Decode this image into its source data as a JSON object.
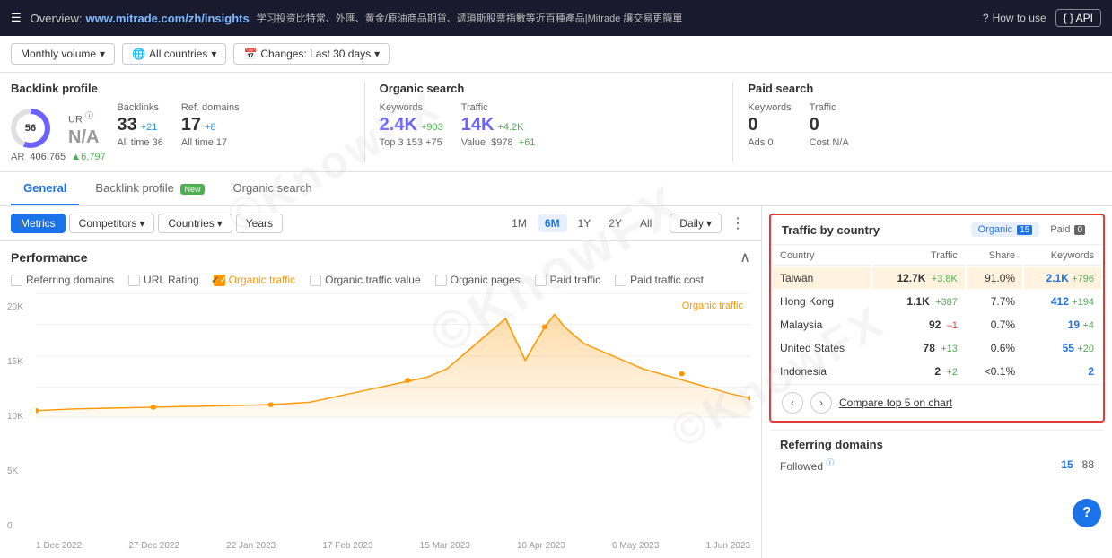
{
  "topnav": {
    "menu_label": "☰",
    "overview_label": "Overview:",
    "site_url": "www.mitrade.com/zh/insights",
    "tagline": "学习投资比特常、外匯、黄金/原油商品期貨、遞瑣斯股票指數等近百種產品|Mitrade 讓交易更簡單",
    "help_label": "How to use",
    "api_label": "{ } API"
  },
  "filters": {
    "volume_label": "Monthly volume",
    "countries_label": "All countries",
    "changes_label": "Changes: Last 30 days"
  },
  "backlink_profile": {
    "title": "Backlink profile",
    "dr_label": "DR",
    "dr_value": "56",
    "ur_label": "UR",
    "ur_value": "N/A",
    "backlinks_label": "Backlinks",
    "backlinks_value": "33",
    "backlinks_delta": "+21",
    "backlinks_sub": "All time  36",
    "refdomains_label": "Ref. domains",
    "refdomains_value": "17",
    "refdomains_delta": "+8",
    "refdomains_sub": "All time  17",
    "ar_label": "AR",
    "ar_value": "406,765",
    "ar_delta": "▲6,797"
  },
  "organic_search": {
    "title": "Organic search",
    "keywords_label": "Keywords",
    "keywords_value": "2.4K",
    "keywords_delta": "+903",
    "traffic_label": "Traffic",
    "traffic_value": "14K",
    "traffic_delta": "+4.2K",
    "top3_label": "Top 3  153  +75",
    "value_label": "Value",
    "value_value": "$978",
    "value_delta": "+61"
  },
  "paid_search": {
    "title": "Paid search",
    "keywords_label": "Keywords",
    "keywords_value": "0",
    "traffic_label": "Traffic",
    "traffic_value": "0",
    "ads_label": "Ads  0",
    "cost_label": "Cost  N/A"
  },
  "tabs": {
    "general": "General",
    "backlink_profile": "Backlink profile",
    "new_badge": "New",
    "organic_search": "Organic search"
  },
  "chart_toolbar": {
    "metrics_label": "Metrics",
    "competitors_label": "Competitors",
    "countries_label": "Countries",
    "years_label": "Years",
    "periods": [
      "1M",
      "6M",
      "1Y",
      "2Y",
      "All"
    ],
    "active_period": "6M",
    "interval_label": "Daily"
  },
  "performance": {
    "title": "Performance",
    "checkboxes": [
      {
        "label": "Referring domains",
        "checked": false
      },
      {
        "label": "URL Rating",
        "checked": false
      },
      {
        "label": "Organic traffic",
        "checked": true
      },
      {
        "label": "Organic traffic value",
        "checked": false
      },
      {
        "label": "Organic pages",
        "checked": false
      },
      {
        "label": "Paid traffic",
        "checked": false
      },
      {
        "label": "Paid traffic cost",
        "checked": false
      }
    ],
    "chart_label": "Organic traffic",
    "y_labels": [
      "20K",
      "15K",
      "10K",
      "5K",
      "0"
    ],
    "x_labels": [
      "1 Dec 2022",
      "27 Dec 2022",
      "22 Jan 2023",
      "17 Feb 2023",
      "15 Mar 2023",
      "10 Apr 2023",
      "6 May 2023",
      "1 Jun 2023"
    ]
  },
  "traffic_country": {
    "title": "Traffic by country",
    "organic_label": "Organic",
    "organic_count": "15",
    "paid_label": "Paid",
    "paid_count": "0",
    "columns": [
      "Country",
      "Traffic",
      "Share",
      "Keywords"
    ],
    "rows": [
      {
        "country": "Taiwan",
        "traffic": "12.7K",
        "delta": "+3.8K",
        "share": "91.0%",
        "keywords": "2.1K",
        "kw_delta": "+796",
        "highlight": true
      },
      {
        "country": "Hong Kong",
        "traffic": "1.1K",
        "delta": "+387",
        "share": "7.7%",
        "keywords": "412",
        "kw_delta": "+194"
      },
      {
        "country": "Malaysia",
        "traffic": "92",
        "delta": "–1",
        "share": "0.7%",
        "keywords": "19",
        "kw_delta": "+4"
      },
      {
        "country": "United States",
        "traffic": "78",
        "delta": "+13",
        "share": "0.6%",
        "keywords": "55",
        "kw_delta": "+20"
      },
      {
        "country": "Indonesia",
        "traffic": "2",
        "delta": "+2",
        "share": "<0.1%",
        "keywords": "2",
        "kw_delta": ""
      }
    ],
    "compare_label": "Compare top 5 on chart"
  },
  "referring_domains": {
    "title": "Referring domains",
    "followed_label": "Followed",
    "followed_value": "15",
    "followed_sub": "88"
  },
  "watermark": "©KnowFX",
  "help_icon": "?"
}
